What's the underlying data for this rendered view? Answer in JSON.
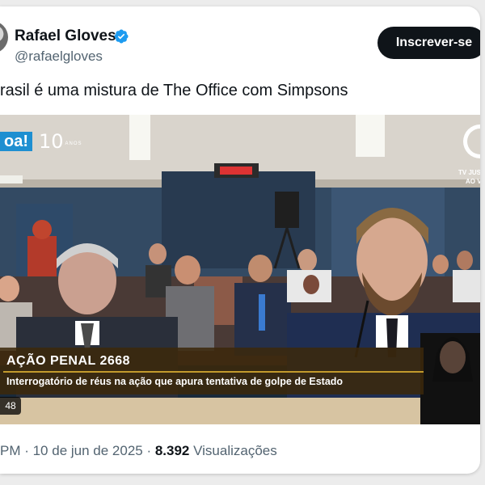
{
  "author": {
    "name": "Rafael Gloves",
    "handle": "@rafaelgloves",
    "verified_color": "#1d9bf0"
  },
  "subscribe_label": "Inscrever-se",
  "tweet_text": "rasil é uma mistura de The Office com Simpsons",
  "video": {
    "channel_logo": "oa!",
    "channel_years": "10",
    "channel_years_label": "ANOS",
    "tv_label_1": "TV JUS",
    "tv_label_2": "AO V",
    "lower_third_title": "AÇÃO PENAL 2668",
    "lower_third_subtitle": "Interrogatório de réus na ação que apura tentativa de golpe de Estado",
    "timer": "48"
  },
  "meta": {
    "time_date": "PM · 10 de jun de 2025 · ",
    "views_count": "8.392",
    "views_label": " Visualizações"
  }
}
